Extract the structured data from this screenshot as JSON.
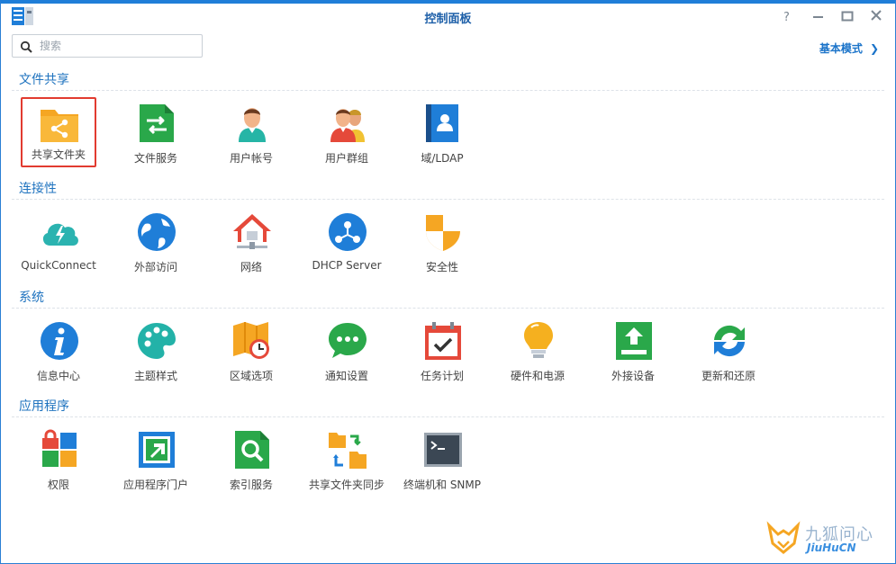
{
  "window": {
    "title": "控制面板",
    "help_label": "?",
    "accent_color": "#1f7ed8"
  },
  "search": {
    "placeholder": "搜索"
  },
  "mode_link": {
    "label": "基本模式",
    "chevron": "❯"
  },
  "sections": [
    {
      "title": "文件共享",
      "items": [
        {
          "label": "共享文件夹",
          "icon": "shared-folder-icon",
          "selected": true
        },
        {
          "label": "文件服务",
          "icon": "file-services-icon"
        },
        {
          "label": "用户帐号",
          "icon": "user-icon"
        },
        {
          "label": "用户群组",
          "icon": "group-icon"
        },
        {
          "label": "域/LDAP",
          "icon": "domain-ldap-icon"
        }
      ]
    },
    {
      "title": "连接性",
      "items": [
        {
          "label": "QuickConnect",
          "icon": "quickconnect-icon"
        },
        {
          "label": "外部访问",
          "icon": "external-access-icon"
        },
        {
          "label": "网络",
          "icon": "network-icon"
        },
        {
          "label": "DHCP Server",
          "icon": "dhcp-server-icon"
        },
        {
          "label": "安全性",
          "icon": "security-shield-icon"
        }
      ]
    },
    {
      "title": "系统",
      "items": [
        {
          "label": "信息中心",
          "icon": "info-center-icon"
        },
        {
          "label": "主题样式",
          "icon": "theme-palette-icon"
        },
        {
          "label": "区域选项",
          "icon": "regional-options-icon"
        },
        {
          "label": "通知设置",
          "icon": "notification-icon"
        },
        {
          "label": "任务计划",
          "icon": "task-scheduler-icon"
        },
        {
          "label": "硬件和电源",
          "icon": "hardware-power-icon"
        },
        {
          "label": "外接设备",
          "icon": "external-devices-icon"
        },
        {
          "label": "更新和还原",
          "icon": "update-restore-icon"
        }
      ]
    },
    {
      "title": "应用程序",
      "items": [
        {
          "label": "权限",
          "icon": "privileges-icon"
        },
        {
          "label": "应用程序门户",
          "icon": "application-portal-icon"
        },
        {
          "label": "索引服务",
          "icon": "indexing-service-icon"
        },
        {
          "label": "共享文件夹同步",
          "icon": "shared-folder-sync-icon"
        },
        {
          "label": "终端机和 SNMP",
          "icon": "terminal-snmp-icon"
        }
      ]
    }
  ],
  "watermark": {
    "cn": "九狐问心",
    "en": "JiuHuCN"
  }
}
